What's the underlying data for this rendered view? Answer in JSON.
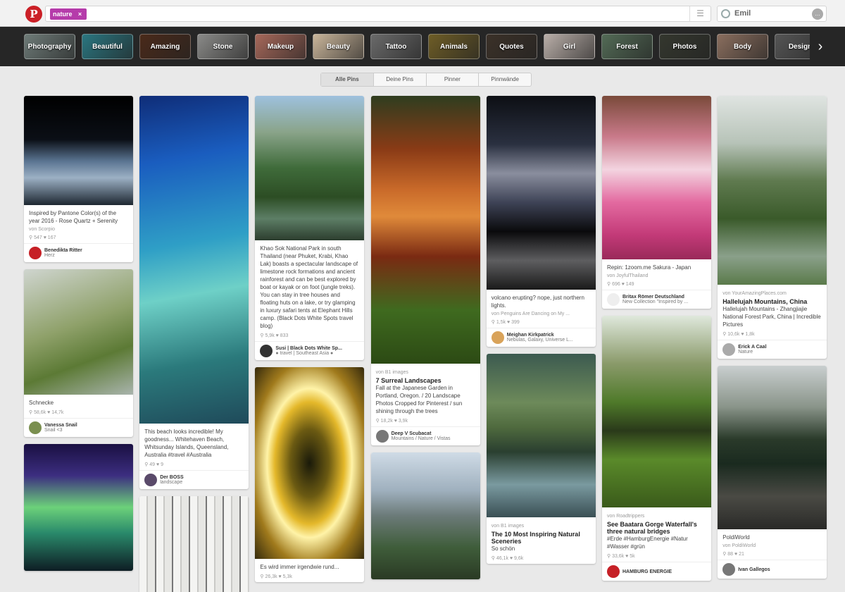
{
  "header": {
    "search_tag": "nature",
    "tag_remove": "×",
    "user": "Emil"
  },
  "categories": [
    {
      "label": "Photography",
      "color": "#6e7b78"
    },
    {
      "label": "Beautiful",
      "color": "#2a7680"
    },
    {
      "label": "Amazing",
      "color": "#4a2a1a"
    },
    {
      "label": "Stone",
      "color": "#8a8a88"
    },
    {
      "label": "Makeup",
      "color": "#a6685a"
    },
    {
      "label": "Beauty",
      "color": "#c9b59a"
    },
    {
      "label": "Tattoo",
      "color": "#6a6a6a"
    },
    {
      "label": "Animals",
      "color": "#6e5d26"
    },
    {
      "label": "Quotes",
      "color": "#3b3128"
    },
    {
      "label": "Girl",
      "color": "#b9aea8"
    },
    {
      "label": "Forest",
      "color": "#536b56"
    },
    {
      "label": "Photos",
      "color": "#34372e"
    },
    {
      "label": "Body",
      "color": "#8a6e5e"
    },
    {
      "label": "Design",
      "color": "#555555"
    }
  ],
  "filters": [
    "Alle Pins",
    "Deine Pins",
    "Pinner",
    "Pinnwände"
  ],
  "columns": [
    [
      {
        "img_h": 155,
        "bg": "linear-gradient(#000 0%,#0b0f16 40%,#5b7592 60%,#9cb0c4 75%,#1d2731 100%)",
        "desc": "Inspired by Pantone Color(s) of the year 2016 - Rose Quartz + Serenity",
        "src": "von Scorpio",
        "stats": "⚲ 547   ♥ 167",
        "name": "Benedikta Ritter",
        "sub": "Herz",
        "av": "#c62026"
      },
      {
        "img_h": 178,
        "bg": "linear-gradient(160deg,#cfd5cf,#8fa16a 45%,#5c7a35 70%,#a9b4ad)",
        "desc": "Schnecke",
        "stats": "⚲ 58,6k   ♥ 14,7k",
        "name": "Vanessa Snail",
        "sub": "Snail <3",
        "av": "#7a8f4f"
      },
      {
        "img_h": 180,
        "bg": "linear-gradient(#1a1042,#3c2e80 25%,#6cd17a 50%,#2a8a6b 70%,#0e1d24)",
        "desc": "",
        "stats": "",
        "name": "",
        "sub": "",
        "av": "#fff"
      }
    ],
    [
      {
        "img_h": 465,
        "bg": "linear-gradient(170deg,#0f2d78,#1a5dbf 20%,#2f9fc6 45%,#6ed0c7 60%,#2b7a7c 80%,#1f4a5a)",
        "desc": "This beach looks incredible! My goodness... Whitehaven Beach, Whitsunday Islands, Queensland, Australia #travel #Australia",
        "stats": "⚲ 49   ♥ 9",
        "name": "Der BOSS",
        "sub": "landscape",
        "av": "#5a4a6a"
      },
      {
        "img_h": 150,
        "bg": "repeating-linear-gradient(90deg,#f4f4f2 0 10px,#c9c9c6 10px 12px,#e7e7e4 12px 22px,#777 22px 24px)",
        "desc": "",
        "stats": "",
        "name": "",
        "sub": "",
        "av": "#fff"
      }
    ],
    [
      {
        "img_h": 205,
        "bg": "linear-gradient(#9ec1de,#8aa48a 25%,#3f6b3a 50%,#2c4d24 70%,#5d7e66 85%,#2c3d2e)",
        "desc": "Khao Sok National Park in south Thailand (near Phuket, Krabi, Khao Lak) boasts a spectacular landscape of limestone rock formations and ancient rainforest and can be best explored by boat or kayak or on foot (jungle treks). You can stay in tree houses and floating huts on a lake, or try glamping in luxury safari tents at Elephant Hills camp. (Black Dots White Spots travel blog)",
        "stats": "⚲ 5,9k   ♥ 833",
        "name": "Susi | Black Dots White Sp...",
        "sub": "● travel | Southeast Asia ●",
        "av": "#333"
      },
      {
        "img_h": 272,
        "bg": "radial-gradient(ellipse at 50% 50%,#1a1a0a 0%,#6b5a12 25%,#e4b82a 45%,#fff3a8 55%,#a07a1c 75%,#352a0c 100%)",
        "desc": "Es wird immer irgendwie rund...",
        "stats": "⚲ 26,3k   ♥ 5,3k",
        "name": "",
        "sub": "",
        "av": "#fff"
      }
    ],
    [
      {
        "img_h": 380,
        "bg": "linear-gradient(#2f3d1f,#8a3b16 20%,#c96a2a 35%,#e08a3a 45%,#7a2a12 60%,#3f6a1f 80%,#2c4a14)",
        "desc": "Fall at the Japanese Garden in Portland, Oregon. / 20 Landscape Photos Cropped for Pinterest / sun shining through the trees",
        "src": "von B1 images",
        "title": "7 Surreal Landscapes",
        "stats": "⚲ 18,2k   ♥ 3,9k",
        "name": "Deep V Scubacat",
        "sub": "Mountains / Nature / Vistas",
        "av": "#777"
      },
      {
        "img_h": 180,
        "bg": "linear-gradient(#cfdbe6,#9fb0be 30%,#6b7a78 50%,#3f5d3a 75%,#2a3a24)",
        "desc": "",
        "stats": "",
        "name": "",
        "sub": "",
        "av": "#fff"
      }
    ],
    [
      {
        "img_h": 275,
        "bg": "linear-gradient(#0d0f14,#2a3040 25%,#8a8e9e 40%,#3e4356 55%,#0a0a0c 70%,#5e5e60 85%,#1a1a1a)",
        "desc": "volcano erupting? nope, just northern lights.",
        "src": "von Penguins Are Dancing on My ...",
        "stats": "⚲ 1,5k   ♥ 399",
        "name": "Meighan Kirkpatrick",
        "sub": "Nebulas, Galaxy, Universe L...",
        "av": "#d9a35a"
      },
      {
        "img_h": 232,
        "bg": "linear-gradient(#3c5a50,#6d8a5a 30%,#4f6a3e 45%,#2a3f30 60%,#7a9aa0 80%,#3a4f54)",
        "desc": "So schön",
        "src": "von B1 images",
        "title": "The 10 Most Inspiring Natural Sceneries",
        "stats": "⚲ 46,1k   ♥ 9,6k",
        "name": "",
        "sub": "",
        "av": "#fff"
      }
    ],
    [
      {
        "img_h": 232,
        "bg": "linear-gradient(#7a4a3a,#c97a8a 25%,#f3d4e0 45%,#e36aa0 65%,#c33a78 85%,#9a2a5a)",
        "desc": "Repin: 1zoom.me Sakura - Japan",
        "src": "von JoyfulThailand",
        "stats": "⚲ 696   ♥ 149",
        "name": "Britax Römer Deutschland",
        "sub": "New Collection \"Inspired by ...",
        "av": "#eee"
      },
      {
        "img_h": 272,
        "bg": "linear-gradient(#dfe8dc,#8a9a6a 25%,#4f7a2a 45%,#2a3a1a 60%,#5a8a2a 75%,#3a5a1a)",
        "desc": "#Erde #HamburgEnergie #Natur #Wasser #grün",
        "src": "von Roadtrippers",
        "title": "See Baatara Gorge Waterfall's three natural bridges",
        "stats": "⚲ 33,6k   ♥ 5k",
        "name": "HAMBURG ENERGIE",
        "sub": "",
        "av": "#c62026"
      }
    ],
    [
      {
        "img_h": 268,
        "bg": "linear-gradient(#dfe4e1,#b7c3b8 25%,#5f7a4f 45%,#3a5a2a 65%,#8aa08a 85%,#5a7a4a)",
        "desc": "Hallelujah Mountains - Zhangjiajie National Forest Park, China | Incredible Pictures",
        "src": "von YourAmazingPlaces.com",
        "title": "Hallelujah Mountains, China",
        "stats": "⚲ 10,6k   ♥ 1,8k",
        "name": "Erick A Caal",
        "sub": "Nature",
        "av": "#aaa"
      },
      {
        "img_h": 232,
        "bg": "linear-gradient(#c9cfcf,#8a958a 25%,#2a3a2a 45%,#1a2a1f 60%,#4a4a44 80%,#2a2a28)",
        "desc": "PoldiWorld",
        "src": "von PoldiWorld",
        "stats": "⚲ 88   ♥ 21",
        "name": "Ivan Gallegos",
        "sub": "",
        "av": "#777"
      }
    ]
  ]
}
